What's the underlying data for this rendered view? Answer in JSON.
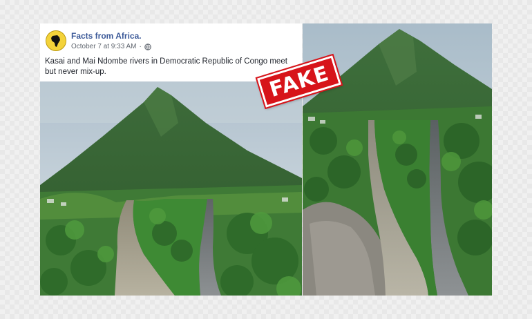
{
  "post": {
    "page_name": "Facts from Africa.",
    "date": "October 7 at 9:33 AM",
    "separator": "·",
    "text": "Kasai and Mai Ndombe rivers in Democratic Republic of Congo meet but never mix-up."
  },
  "stamp": {
    "label": "FAKE"
  },
  "icons": {
    "avatar": "africa-map-icon",
    "privacy": "globe-icon"
  },
  "colors": {
    "page_name": "#3b5998",
    "stamp": "#d7141a",
    "meta": "#616770"
  }
}
